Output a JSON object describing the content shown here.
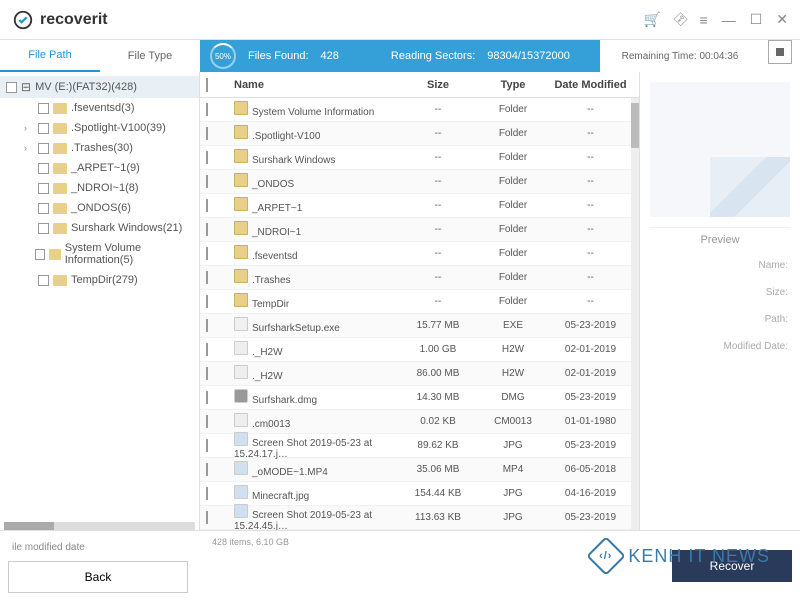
{
  "app": {
    "name": "recoverit"
  },
  "titlebar": {
    "min": "—",
    "max": "☐",
    "close": "✕"
  },
  "tabs": {
    "file_path": "File Path",
    "file_type": "File Type"
  },
  "progress": {
    "percent": "50%",
    "files_found_label": "Files Found:",
    "files_found": "428",
    "reading_label": "Reading Sectors:",
    "reading_value": "98304/15372000",
    "remaining_label": "Remaining Time:",
    "remaining_value": "00:04:36"
  },
  "tree": {
    "root": "MV (E:)(FAT32)(428)",
    "items": [
      ".fseventsd(3)",
      ".Spotlight-V100(39)",
      ".Trashes(30)",
      "_ARPET~1(9)",
      "_NDROI~1(8)",
      "_ONDOS(6)",
      "Surshark Windows(21)",
      "System Volume Information(5)",
      "TempDir(279)"
    ]
  },
  "columns": {
    "name": "Name",
    "size": "Size",
    "type": "Type",
    "date": "Date Modified"
  },
  "files": [
    {
      "name": "System Volume Information",
      "size": "--",
      "type": "Folder",
      "date": "--",
      "ico": "folder"
    },
    {
      "name": ".Spotlight-V100",
      "size": "--",
      "type": "Folder",
      "date": "--",
      "ico": "folder"
    },
    {
      "name": "Surshark Windows",
      "size": "--",
      "type": "Folder",
      "date": "--",
      "ico": "folder"
    },
    {
      "name": "_ONDOS",
      "size": "--",
      "type": "Folder",
      "date": "--",
      "ico": "folder"
    },
    {
      "name": "_ARPET~1",
      "size": "--",
      "type": "Folder",
      "date": "--",
      "ico": "folder"
    },
    {
      "name": "_NDROI~1",
      "size": "--",
      "type": "Folder",
      "date": "--",
      "ico": "folder"
    },
    {
      "name": ".fseventsd",
      "size": "--",
      "type": "Folder",
      "date": "--",
      "ico": "folder"
    },
    {
      "name": ".Trashes",
      "size": "--",
      "type": "Folder",
      "date": "--",
      "ico": "folder"
    },
    {
      "name": "TempDir",
      "size": "--",
      "type": "Folder",
      "date": "--",
      "ico": "folder"
    },
    {
      "name": "SurfsharkSetup.exe",
      "size": "15.77  MB",
      "type": "EXE",
      "date": "05-23-2019",
      "ico": "exe"
    },
    {
      "name": "._H2W",
      "size": "1.00  GB",
      "type": "H2W",
      "date": "02-01-2019",
      "ico": "file"
    },
    {
      "name": "._H2W",
      "size": "86.00  MB",
      "type": "H2W",
      "date": "02-01-2019",
      "ico": "file"
    },
    {
      "name": "Surfshark.dmg",
      "size": "14.30  MB",
      "type": "DMG",
      "date": "05-23-2019",
      "ico": "dmg"
    },
    {
      "name": ".cm0013",
      "size": "0.02  KB",
      "type": "CM0013",
      "date": "01-01-1980",
      "ico": "file"
    },
    {
      "name": "Screen Shot 2019-05-23 at 15.24.17.j…",
      "size": "89.62  KB",
      "type": "JPG",
      "date": "05-23-2019",
      "ico": "img"
    },
    {
      "name": "_oMODE~1.MP4",
      "size": "35.06  MB",
      "type": "MP4",
      "date": "06-05-2018",
      "ico": "img"
    },
    {
      "name": "Minecraft.jpg",
      "size": "154.44  KB",
      "type": "JPG",
      "date": "04-16-2019",
      "ico": "img"
    },
    {
      "name": "Screen Shot 2019-05-23 at 15.24.45.j…",
      "size": "113.63  KB",
      "type": "JPG",
      "date": "05-23-2019",
      "ico": "img"
    }
  ],
  "preview": {
    "label": "Preview",
    "name": "Name:",
    "size": "Size:",
    "path": "Path:",
    "modified": "Modified Date:"
  },
  "footer": {
    "mod_date": "ile modified date",
    "back": "Back",
    "status": "428 items, 6.10  GB",
    "recover": "Recover"
  },
  "watermark": "KENH IT NEWS"
}
